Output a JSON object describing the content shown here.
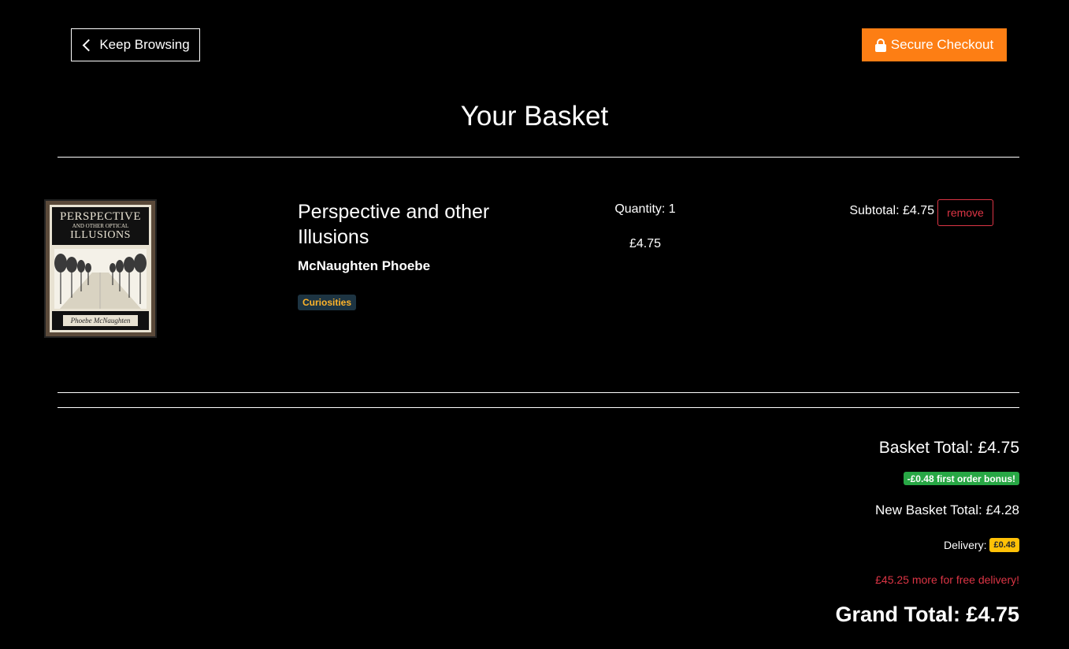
{
  "header": {
    "keep_browsing_label": "Keep Browsing",
    "secure_checkout_label": "Secure Checkout",
    "checkout_color": "#fd7e14"
  },
  "page": {
    "title": "Your Basket"
  },
  "basket_items": [
    {
      "cover": {
        "title_line1": "PERSPECTIVE",
        "title_line2": "AND OTHER OPTICAL",
        "title_line3": "ILLUSIONS",
        "author": "Phoebe McNaughten"
      },
      "title": "Perspective and other Illusions",
      "author": "McNaughten Phoebe",
      "category": "Curiosities",
      "quantity_text": "Quantity: 1",
      "unit_price": "£4.75",
      "subtotal_text": "Subtotal: £4.75",
      "remove_label": "remove"
    }
  ],
  "totals": {
    "basket_total_text": "Basket Total: £4.75",
    "bonus_badge": "-£0.48 first order bonus!",
    "new_basket_total_text": "New Basket Total: £4.28",
    "delivery_label": "Delivery:",
    "delivery_badge": "£0.48",
    "free_delivery_message": "£45.25 more for free delivery!",
    "grand_total_text": "Grand Total: £4.75"
  },
  "icons": {
    "back": "chevron-left-icon",
    "lock": "lock-icon"
  },
  "colors": {
    "background": "#000000",
    "remove": "#dc3545",
    "bonus": "#28a745",
    "delivery": "#ffc107",
    "category_text": "#ffb42a"
  }
}
